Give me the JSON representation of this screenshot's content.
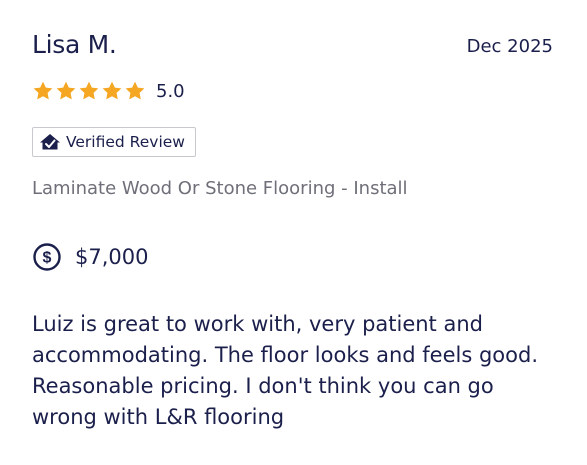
{
  "review": {
    "reviewer_name": "Lisa M.",
    "date": "Dec 2025",
    "rating": {
      "stars": 5,
      "max_stars": 5,
      "value_text": "5.0"
    },
    "verified_badge": {
      "label": "Verified Review",
      "icon": "house-check-icon"
    },
    "service": "Laminate Wood Or Stone Flooring - Install",
    "price": {
      "icon": "dollar-circle-icon",
      "amount": "$7,000"
    },
    "body": "Luiz is great to work with, very patient and accommodating. The floor looks and feels good. Reasonable pricing. I don't think you can go wrong with L&R flooring"
  },
  "colors": {
    "star": "#f5a623",
    "text_primary": "#1b1f4b",
    "text_secondary": "#6e6f78",
    "badge_border": "#c8c9cf"
  }
}
